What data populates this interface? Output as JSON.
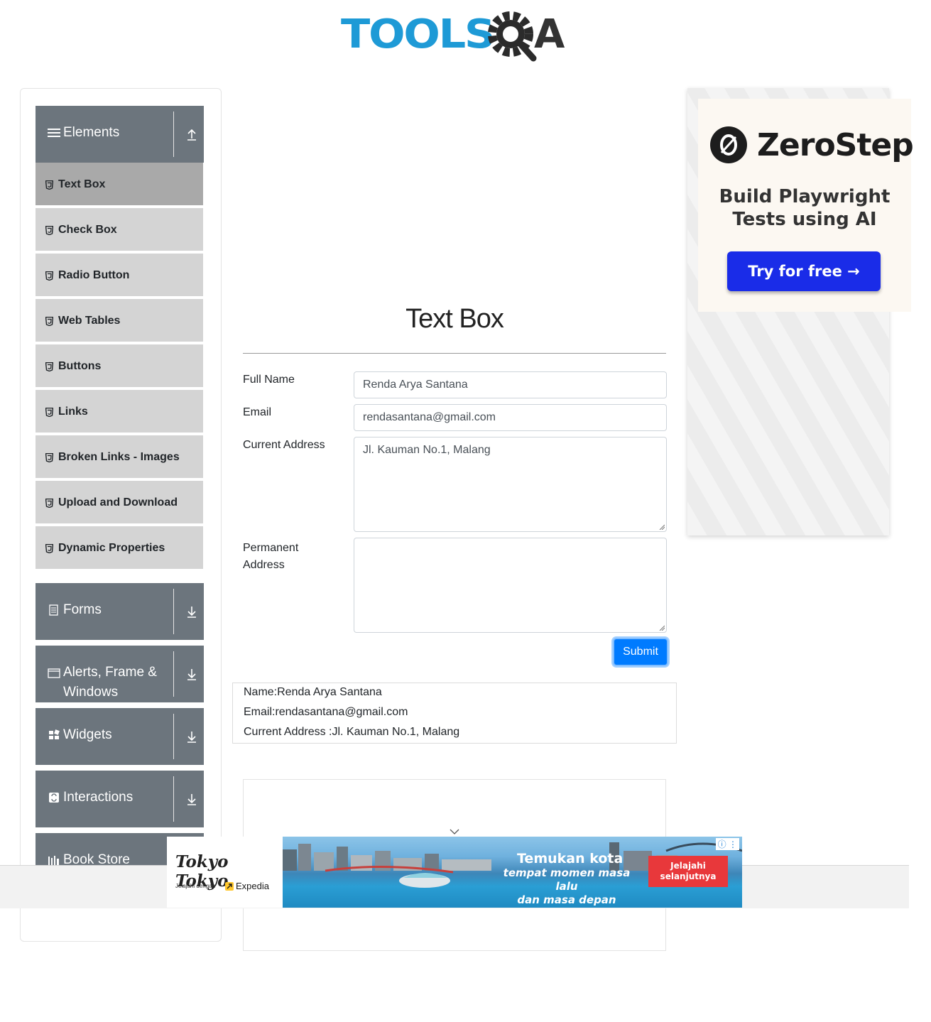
{
  "logo": {
    "text": "TOOLS",
    "text2": "A"
  },
  "sidebar": {
    "groups": [
      {
        "label": "Elements",
        "icon": "hamburger-icon",
        "arrow": "collapse-up-icon"
      },
      {
        "label": "Forms",
        "icon": "form-icon",
        "arrow": "expand-down-icon"
      },
      {
        "label": "Alerts, Frame &",
        "label2": "Windows",
        "icon": "window-icon",
        "arrow": "expand-down-icon"
      },
      {
        "label": "Widgets",
        "icon": "widgets-icon",
        "arrow": "expand-down-icon"
      },
      {
        "label": "Interactions",
        "icon": "interactions-icon",
        "arrow": "expand-down-icon"
      },
      {
        "label": "Book Store",
        "icon": "bookstore-icon"
      }
    ],
    "items": [
      {
        "label": "Text Box"
      },
      {
        "label": "Check Box"
      },
      {
        "label": "Radio Button"
      },
      {
        "label": "Web Tables"
      },
      {
        "label": "Buttons"
      },
      {
        "label": "Links"
      },
      {
        "label": "Broken Links - Images"
      },
      {
        "label": "Upload and Download"
      },
      {
        "label": "Dynamic Properties"
      }
    ]
  },
  "main": {
    "title": "Text Box",
    "form": {
      "full_name_label": "Full Name",
      "full_name_value": "Renda Arya Santana",
      "email_label": "Email",
      "email_value": "rendasantana@gmail.com",
      "current_address_label": "Current Address",
      "current_address_value": "Jl. Kauman No.1, Malang",
      "permanent_address_label_1": "Permanent",
      "permanent_address_label_2": "Address",
      "permanent_address_value": "",
      "submit_label": "Submit"
    },
    "output": {
      "name": "Name:Renda Arya Santana",
      "email": "Email:rendasantana@gmail.com",
      "current_address": "Current Address :Jl. Kauman No.1, Malang"
    }
  },
  "ads": {
    "side": {
      "brand": "ZeroStep",
      "tagline_1": "Build Playwright",
      "tagline_2": "Tests using AI",
      "cta": "Try for free →"
    },
    "banner": {
      "brand": "Tokyo Tokyo",
      "partner_prefix": "Jelajahi dengan",
      "partner": "Expedia",
      "title": "Temukan kota",
      "subtitle_1": "tempat momen masa lalu",
      "subtitle_2": "dan masa depan berpadu",
      "cta_1": "Jelajahi",
      "cta_2": "selanjutnya"
    }
  },
  "colors": {
    "sidebar_header": "#6c757d",
    "menu_item": "#d4d4d4",
    "menu_active": "#a9a9a9",
    "primary": "#007bff",
    "logo_blue": "#1e9ad6"
  }
}
